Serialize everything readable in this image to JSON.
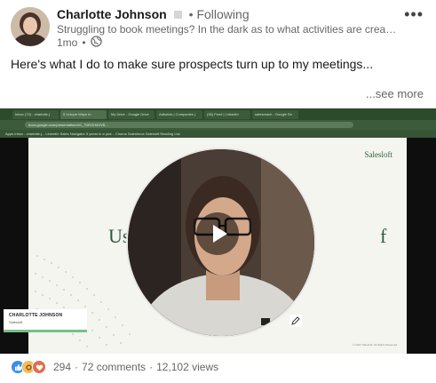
{
  "post": {
    "author": "Charlotte Johnson",
    "follow_status": "• Following",
    "subtitle": "Struggling to book meetings? In the dark as to what activities are creati...",
    "time_ago": "1mo",
    "time_separator": "•",
    "visibility_icon": "globe-icon",
    "more_icon": "more-horizontal-icon",
    "more_label": "•••",
    "body": "Here's what I do to make sure prospects turn up to my meetings...",
    "see_more": "...see more"
  },
  "video": {
    "browser_tabs": [
      "Inbox (73) - charlotte.j",
      "5 Unique Ways to",
      "My Drive - Google Drive",
      "Adbuilds | Companies |",
      "(36) Feed | LinkedIn",
      "salesreach - Google Se"
    ],
    "url": "docs.google.com/presentation/d/1_7DEGH4VVB...",
    "bookmarks": "Apps   Inbox - charlotte.j...   LinkedIn   Sales Navigator   5 years in a pod...   Chorus   Salesforce   Salesloft   Reading List",
    "slide_logo": "Salesloft",
    "slide_title_left": "Us",
    "slide_title_right": "f",
    "slide_footer": "© 2021 Salesloft. All Rights Reserved.",
    "name_tag_name": "CHARLOTTE JOHNSON",
    "name_tag_company": "Salesloft",
    "play_icon": "play-icon",
    "edit_icon": "pencil-icon"
  },
  "social": {
    "reactions": [
      "like-icon",
      "support-icon",
      "love-icon"
    ],
    "reaction_count": "294",
    "sep": "·",
    "comments": "72 comments",
    "views": "12,102 views"
  },
  "colors": {
    "salesloft_green": "#2f5a3c",
    "name_tag_bar": "#78c08a",
    "like": "#378fe9",
    "support": "#f5bb5c",
    "love": "#df704d"
  }
}
